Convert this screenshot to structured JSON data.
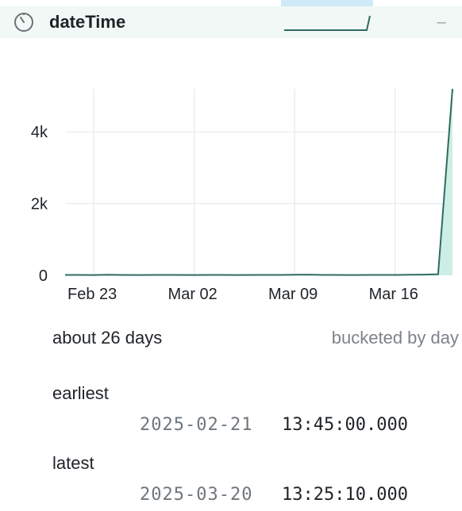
{
  "column": {
    "name": "dateTime",
    "collapse_label": "–"
  },
  "summary": {
    "span": "about 26 days",
    "bucketing": "bucketed by day"
  },
  "stats": {
    "earliest": {
      "label": "earliest",
      "date": "2025-02-21",
      "time": "13:45:00.000"
    },
    "latest": {
      "label": "latest",
      "date": "2025-03-20",
      "time": "13:25:10.000"
    }
  },
  "colors": {
    "header_bg": "#f1f8f5",
    "line": "#2f6b62",
    "area_fill": "#cdeee4",
    "accent": "#cfe9f7"
  },
  "icons": {
    "header": "clock-icon"
  },
  "chart_data": {
    "type": "area",
    "x": [
      "2025-02-21",
      "2025-02-22",
      "2025-02-23",
      "2025-02-24",
      "2025-02-25",
      "2025-02-26",
      "2025-02-27",
      "2025-02-28",
      "2025-03-01",
      "2025-03-02",
      "2025-03-03",
      "2025-03-04",
      "2025-03-05",
      "2025-03-06",
      "2025-03-07",
      "2025-03-08",
      "2025-03-09",
      "2025-03-10",
      "2025-03-11",
      "2025-03-12",
      "2025-03-13",
      "2025-03-14",
      "2025-03-15",
      "2025-03-16",
      "2025-03-17",
      "2025-03-18",
      "2025-03-19",
      "2025-03-20"
    ],
    "values": [
      10,
      12,
      8,
      15,
      10,
      9,
      11,
      12,
      10,
      8,
      10,
      12,
      9,
      11,
      10,
      12,
      15,
      20,
      12,
      10,
      9,
      11,
      10,
      12,
      15,
      20,
      30,
      5200
    ],
    "x_tick_labels": [
      "Feb 23",
      "Mar 02",
      "Mar 09",
      "Mar 16"
    ],
    "y_tick_labels": [
      "0",
      "2k",
      "4k"
    ],
    "y_ticks": [
      0,
      2000,
      4000
    ],
    "ylim": [
      0,
      5200
    ],
    "grid": true,
    "legend": "none"
  }
}
